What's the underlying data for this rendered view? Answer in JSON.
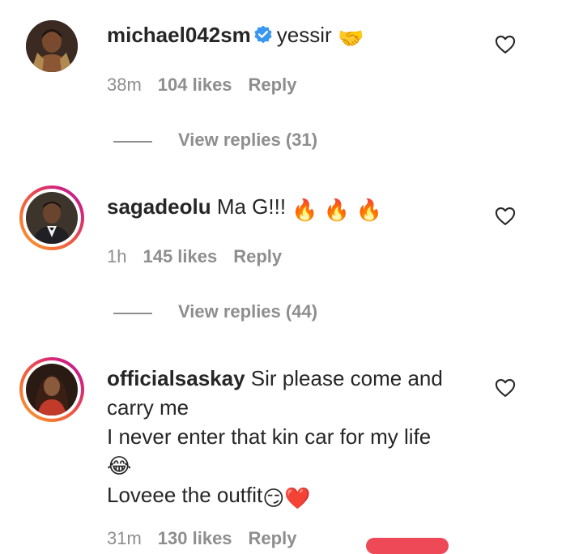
{
  "comments": [
    {
      "username": "michael042sm",
      "verified": true,
      "text": "yessir",
      "emoji": "🤝",
      "time": "38m",
      "likes": "104 likes",
      "reply": "Reply",
      "view_replies": "View replies (31)"
    },
    {
      "username": "sagadeolu",
      "verified": false,
      "text": "Ma G!!!",
      "emoji": "🔥 🔥 🔥",
      "time": "1h",
      "likes": "145 likes",
      "reply": "Reply",
      "view_replies": "View replies (44)"
    },
    {
      "username": "officialsaskay",
      "verified": false,
      "text_line1": "Sir please come and carry me",
      "text_line2": "I never enter that kin car for my life",
      "emoji_line3": "😂",
      "text_line4": "Loveee the outfit",
      "emoji_line4": "😏❤️",
      "time": "31m",
      "likes": "130 likes",
      "reply": "Reply"
    }
  ],
  "colors": {
    "text": "#262626",
    "muted": "#8e8e8e",
    "verified": "#3897f0",
    "story_ring": "#f15b3f"
  },
  "icons": [
    "verified-badge-icon",
    "heart-icon"
  ]
}
